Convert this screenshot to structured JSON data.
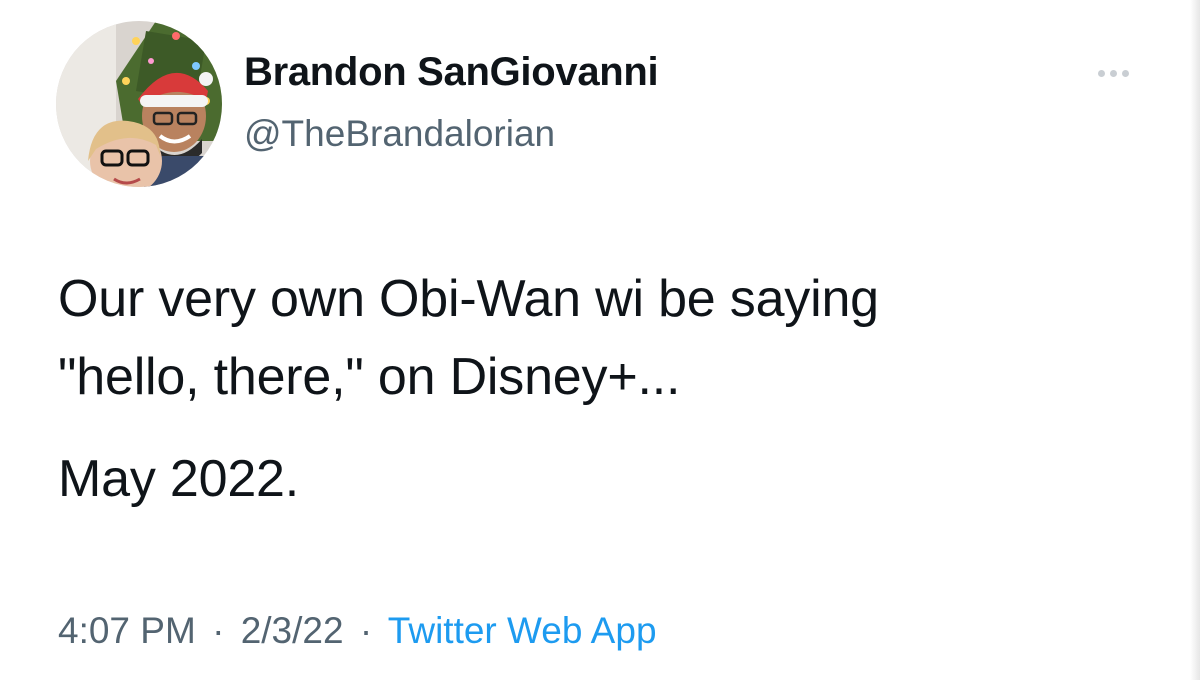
{
  "tweet": {
    "author": {
      "name": "Brandon SanGiovanni",
      "handle": "@TheBrandalorian"
    },
    "text_lines": [
      "Our very own Obi-Wan wi be saying",
      "\"hello, there,\" on Disney+..."
    ],
    "text_para2": "May 2022.",
    "meta": {
      "time": "4:07 PM",
      "separator": "·",
      "date": "2/3/22",
      "source": "Twitter Web App"
    }
  },
  "colors": {
    "text_primary": "#0f1419",
    "text_secondary": "#536471",
    "link": "#1d9bf0"
  },
  "icons": {
    "more": "more-horizontal-icon"
  }
}
